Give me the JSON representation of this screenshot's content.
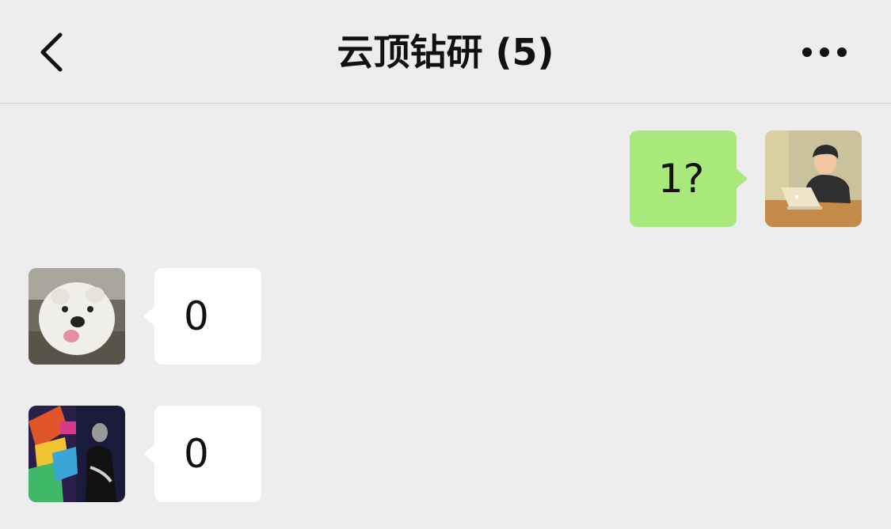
{
  "header": {
    "title": "云顶钻研 (5)",
    "back_icon": "chevron-left-icon",
    "more_icon": "ellipsis-icon"
  },
  "messages": [
    {
      "sender": "self",
      "text": "1?",
      "avatar": "person-with-laptop-avatar",
      "bubble_color": "#a9e87a"
    },
    {
      "sender": "other",
      "text": "0",
      "avatar": "white-dog-avatar",
      "bubble_color": "#ffffff"
    },
    {
      "sender": "other",
      "text": "0",
      "avatar": "neon-room-avatar",
      "bubble_color": "#ffffff"
    }
  ]
}
